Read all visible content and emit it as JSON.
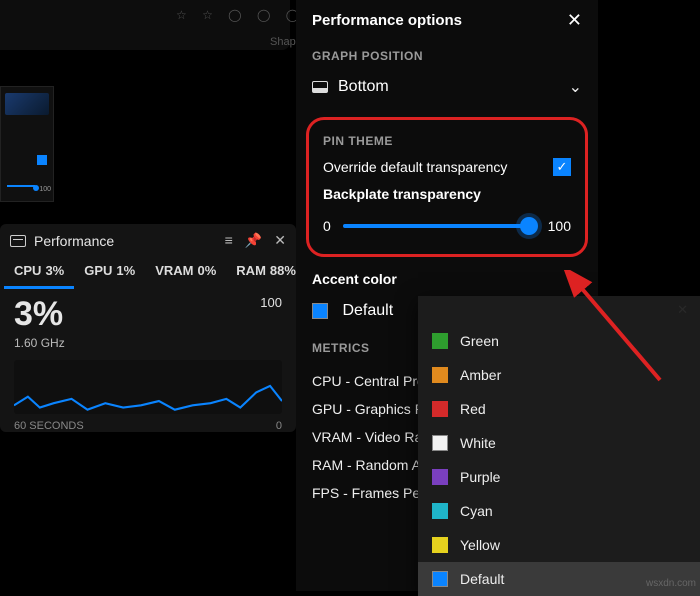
{
  "bg": {
    "shapes_label": "Shap"
  },
  "thumb": {
    "value": "100"
  },
  "perf_widget": {
    "title": "Performance",
    "tabs": [
      {
        "name": "CPU",
        "value": "3%"
      },
      {
        "name": "GPU",
        "value": "1%"
      },
      {
        "name": "VRAM",
        "value": "0%"
      },
      {
        "name": "RAM",
        "value": "88%"
      }
    ],
    "big_value": "3%",
    "scale_max": "100",
    "subtitle": "1.60 GHz",
    "time_label": "60 SECONDS",
    "scale_zero": "0"
  },
  "options": {
    "title": "Performance options",
    "graph_position_label": "GRAPH POSITION",
    "graph_position_value": "Bottom",
    "pin_theme_label": "PIN THEME",
    "override_label": "Override default transparency",
    "backplate_label": "Backplate transparency",
    "slider_min": "0",
    "slider_max": "100",
    "accent_head": "Accent color",
    "accent_value": "Default",
    "accent_swatch_color": "#0a84ff",
    "metrics_label": "METRICS",
    "metrics": [
      "CPU - Central Proc",
      "GPU - Graphics Pro",
      "VRAM - Video Ran",
      "RAM - Random Ac",
      "FPS - Frames Per S"
    ]
  },
  "accent_menu": {
    "head": "",
    "items": [
      {
        "label": "Green",
        "color": "#2e9e2e"
      },
      {
        "label": "Amber",
        "color": "#e08a1e"
      },
      {
        "label": "Red",
        "color": "#d42a2a"
      },
      {
        "label": "White",
        "color": "#f2f2f2",
        "border": true
      },
      {
        "label": "Purple",
        "color": "#7a3fbf"
      },
      {
        "label": "Cyan",
        "color": "#1fb5c9"
      },
      {
        "label": "Yellow",
        "color": "#e6d21e"
      },
      {
        "label": "Default",
        "color": "#0a84ff",
        "selected": true,
        "border": true
      }
    ]
  },
  "watermark": "wsxdn.com"
}
